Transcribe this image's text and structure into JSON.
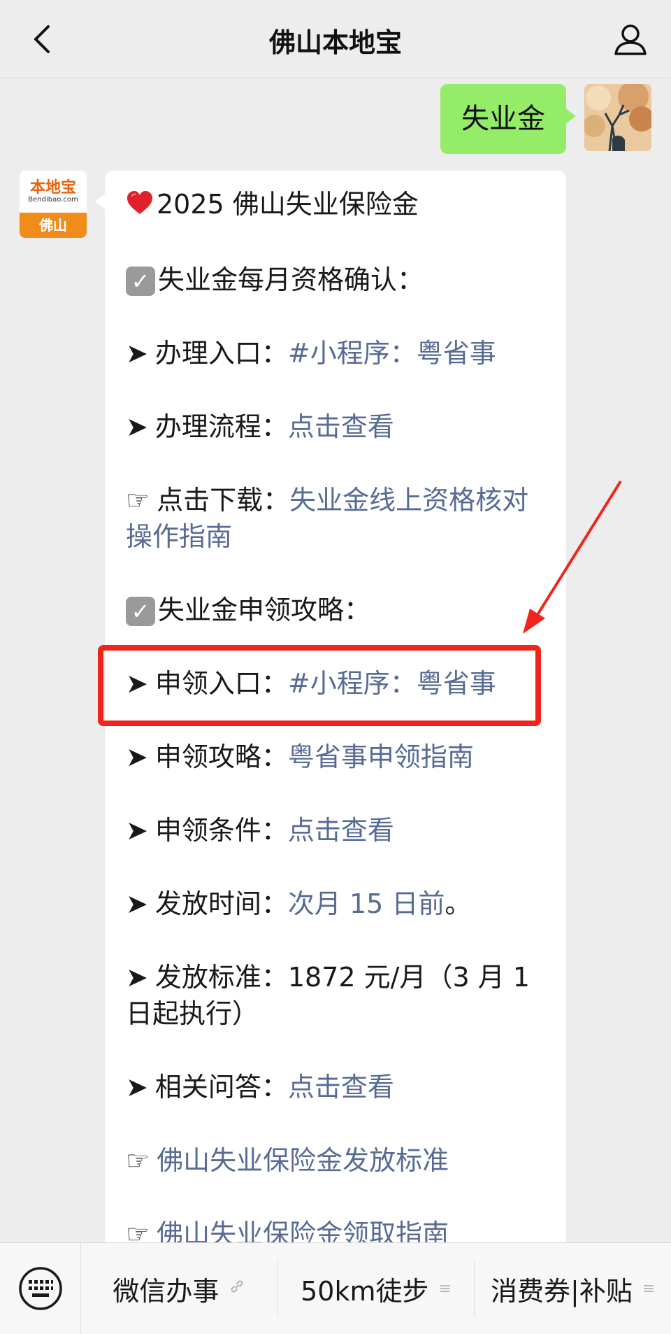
{
  "header": {
    "title": "佛山本地宝"
  },
  "outgoing": {
    "text": "失业金"
  },
  "bot": {
    "avatar_brand": "本地宝",
    "avatar_site": "Bendibao.com",
    "avatar_city": "佛山",
    "title": "2025 佛山失业保险金",
    "section1": "失业金每月资格确认：",
    "item1_label": "办理入口：",
    "item1_link": "#小程序：粤省事",
    "item2_label": "办理流程：",
    "item2_link": "点击查看",
    "item3_label": "点击下载：",
    "item3_link": "失业金线上资格核对操作指南",
    "section2": "失业金申领攻略：",
    "item4_label": "申领入口：",
    "item4_link": "#小程序：粤省事",
    "item5_label": "申领攻略：",
    "item5_link": "粤省事申领指南",
    "item6_label": "申领条件：",
    "item6_link": "点击查看",
    "item7_label": "发放时间：",
    "item7_link": "次月 15 日前",
    "item7_suffix": "。",
    "item8_label": "发放标准：",
    "item8_text": "1872 元/月（3 月 1 日起执行）",
    "item9_label": "相关问答：",
    "item9_link": "点击查看",
    "link10": "佛山失业保险金发放标准",
    "link11": "佛山失业保险金领取指南"
  },
  "bottom_menu": {
    "item1": "微信办事",
    "item2": "50km徒步",
    "item3": "消费券|补贴",
    "item2_suffix": "≡",
    "item3_suffix": "≡"
  },
  "colors": {
    "link": "#576b95",
    "outgoing_bubble": "#95ec69",
    "highlight": "#f0241c"
  }
}
